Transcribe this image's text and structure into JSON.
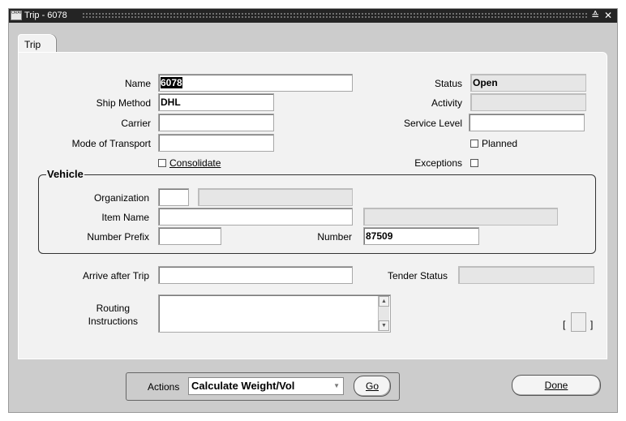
{
  "window": {
    "title": "Trip - 6078",
    "icon_text": "ORACLE"
  },
  "tab": {
    "label": "Trip"
  },
  "form": {
    "name": {
      "label": "Name",
      "value": "6078"
    },
    "ship_method": {
      "label": "Ship Method",
      "value": "DHL"
    },
    "carrier": {
      "label": "Carrier",
      "value": ""
    },
    "mode_of_transport": {
      "label": "Mode of Transport",
      "value": ""
    },
    "consolidate": {
      "label": "Consolidate",
      "checked": false
    },
    "status": {
      "label": "Status",
      "value": "Open"
    },
    "activity": {
      "label": "Activity",
      "value": ""
    },
    "service_level": {
      "label": "Service Level",
      "value": ""
    },
    "planned": {
      "label": "Planned",
      "checked": false
    },
    "exceptions": {
      "label": "Exceptions",
      "checked": false
    },
    "arrive_after_trip": {
      "label": "Arrive after Trip",
      "value": ""
    },
    "tender_status": {
      "label": "Tender Status",
      "value": ""
    },
    "routing_instructions": {
      "label_line1": "Routing",
      "label_line2": "Instructions",
      "value": ""
    }
  },
  "vehicle": {
    "title": "Vehicle",
    "organization": {
      "label": "Organization",
      "value": "",
      "desc": ""
    },
    "item_name": {
      "label": "Item Name",
      "value": "",
      "desc": ""
    },
    "number_prefix": {
      "label": "Number Prefix",
      "value": ""
    },
    "number": {
      "label": "Number",
      "value": "87509"
    }
  },
  "actions": {
    "label": "Actions",
    "selected": "Calculate Weight/Vol",
    "go_label": "Go",
    "done_label": "Done"
  },
  "colors": {
    "titlebar": "#242424",
    "window_bg": "#cccccc",
    "panel_bg": "#f2f2f2",
    "readonly_field": "#e6e6e6"
  }
}
